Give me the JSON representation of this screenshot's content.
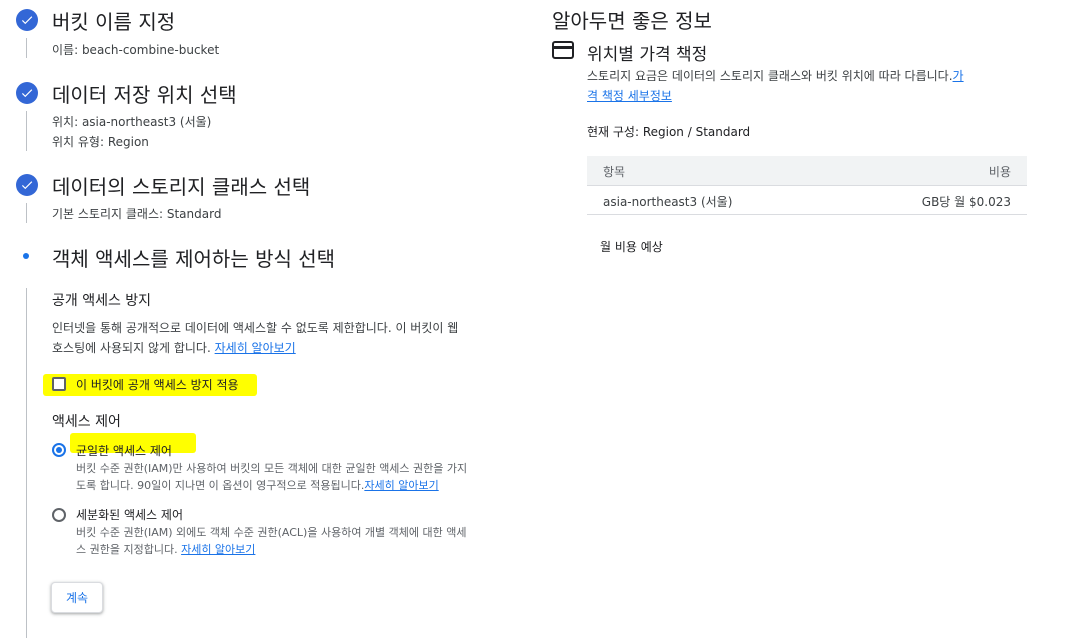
{
  "steps": [
    {
      "title": "버킷 이름 지정",
      "details": [
        "이름: beach-combine-bucket"
      ]
    },
    {
      "title": "데이터 저장 위치 선택",
      "details": [
        "위치: asia-northeast3 (서울)",
        "위치 유형: Region"
      ]
    },
    {
      "title": "데이터의 스토리지 클래스 선택",
      "details": [
        "기본 스토리지 클래스: Standard"
      ]
    },
    {
      "title": "객체 액세스를 제어하는 방식 선택"
    }
  ],
  "public_access": {
    "heading": "공개 액세스 방지",
    "desc_line1": "인터넷을 통해 공개적으로 데이터에 액세스할 수 없도록 제한합니다. 이 버킷이 웹",
    "desc_line2": "호스팅에 사용되지 않게 합니다.",
    "learn_more": "자세히 알아보기",
    "checkbox_label": "이 버킷에 공개 액세스 방지 적용",
    "checkbox_checked": false
  },
  "access_control": {
    "heading": "액세스 제어",
    "options": [
      {
        "label": "균일한 액세스 제어",
        "desc_line1": "버킷 수준 권한(IAM)만 사용하여 버킷의 모든 객체에 대한 균일한 액세스 권한을 가지",
        "desc_line2": "도록 합니다. 90일이 지나면 이 옵션이 영구적으로 적용됩니다.",
        "learn_more": "자세히 알아보기",
        "selected": true
      },
      {
        "label": "세분화된 액세스 제어",
        "desc_line1": "버킷 수준 권한(IAM) 외에도 객체 수준 권한(ACL)을 사용하여 개별 객체에 대한 액세",
        "desc_line2": "스 권한을 지정합니다.",
        "learn_more": "자세히 알아보기",
        "selected": false
      }
    ]
  },
  "continue_label": "계속",
  "info_panel": {
    "title": "알아두면 좋은 정보",
    "section_title": "위치별 가격 책정",
    "section_desc": "스토리지 요금은 데이터의 스토리지 클래스와 버킷 위치에 따라 다릅니다.",
    "link_part1": "가",
    "link_part2": "격 책정 세부정보",
    "current_config": "현재 구성: Region / Standard",
    "table": {
      "headers": [
        "항목",
        "비용"
      ],
      "rows": [
        [
          "asia-northeast3 (서울)",
          "GB당 월 $0.023"
        ]
      ]
    },
    "monthly_estimate": "월 비용 예상"
  },
  "colors": {
    "accent": "#1a73e8",
    "step_done": "#3367d6",
    "highlight": "#ffff00"
  }
}
